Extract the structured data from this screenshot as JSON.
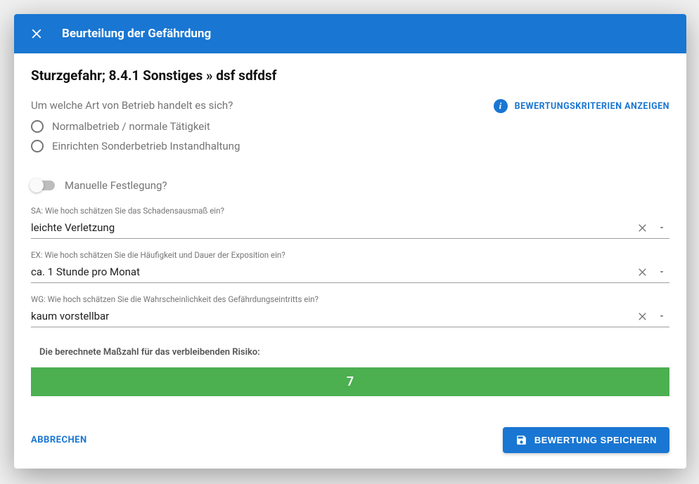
{
  "header": {
    "title": "Beurteilung der Gefährdung"
  },
  "page_title": "Sturzgefahr; 8.4.1 Sonstiges » dsf sdfdsf",
  "criteria_link": "BEWERTUNGSKRITERIEN ANZEIGEN",
  "operation_type": {
    "label": "Um welche Art von Betrieb handelt es sich?",
    "options": [
      "Normalbetrieb / normale Tätigkeit",
      "Einrichten Sonderbetrieb Instandhaltung"
    ]
  },
  "manual_toggle": {
    "label": "Manuelle Festlegung?",
    "value": false
  },
  "fields": {
    "sa": {
      "label": "SA: Wie hoch schätzen Sie das Schadensausmaß ein?",
      "value": "leichte Verletzung"
    },
    "ex": {
      "label": "EX: Wie hoch schätzen Sie die Häufigkeit und Dauer der Exposition ein?",
      "value": "ca. 1 Stunde pro Monat"
    },
    "wg": {
      "label": "WG: Wie hoch schätzen Sie die Wahrscheinlichkeit des Gefährdungseintritts ein?",
      "value": "kaum vorstellbar"
    }
  },
  "risk": {
    "label": "Die berechnete Maßzahl für das verbleibenden Risiko:",
    "value": "7",
    "color": "#4caf50"
  },
  "footer": {
    "cancel": "ABBRECHEN",
    "save": "BEWERTUNG SPEICHERN"
  }
}
